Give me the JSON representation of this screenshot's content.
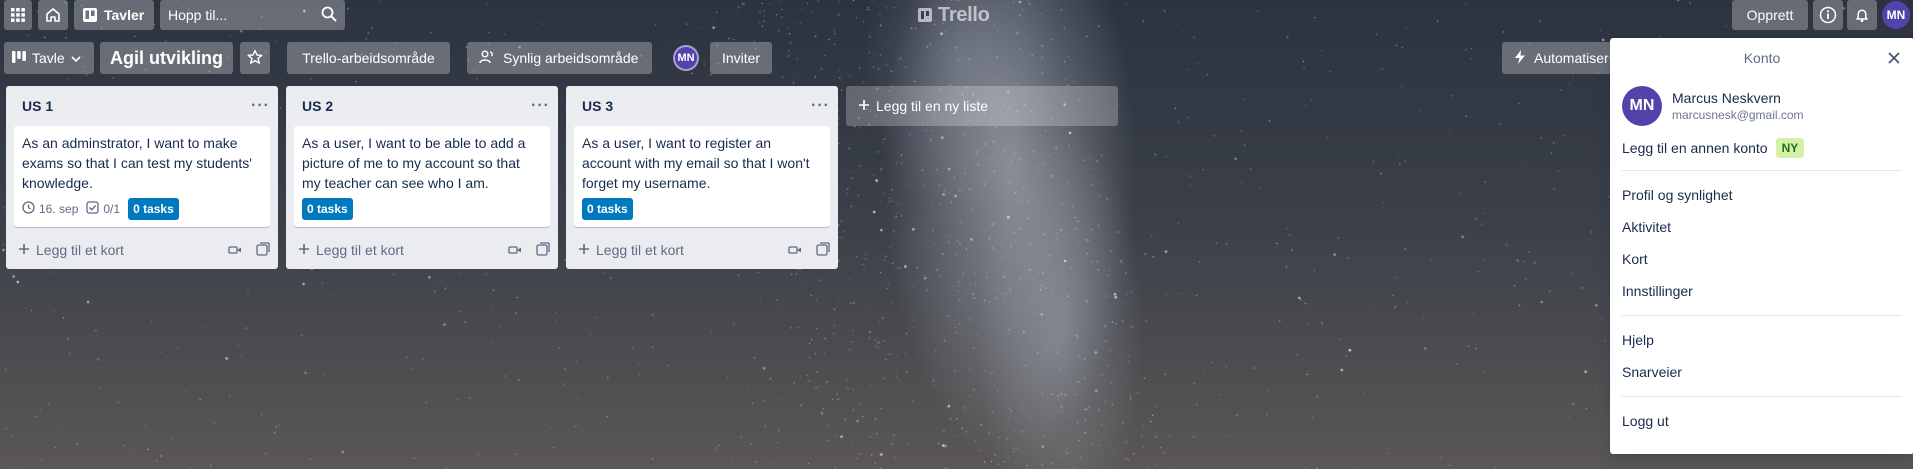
{
  "topbar": {
    "boards_label": "Tavler",
    "search_placeholder": "Hopp til...",
    "logo_text": "Trello",
    "create_label": "Opprett",
    "avatar_initials": "MN"
  },
  "board_header": {
    "view_label": "Tavle",
    "board_name": "Agil utvikling",
    "workspace_label": "Trello-arbeidsområde",
    "visibility_label": "Synlig arbeidsområde",
    "member_initials": "MN",
    "invite_label": "Inviter",
    "automation_label": "Automatiser"
  },
  "lists": [
    {
      "title": "US 1",
      "card_text": "As an adminstrator, I want to make exams so that I can test my students' knowledge.",
      "due_date": "16. sep",
      "checklist": "0/1",
      "label": "0 tasks",
      "add_card": "Legg til et kort"
    },
    {
      "title": "US 2",
      "card_text": "As a user, I want to be able to add a picture of me to my account so that my teacher can see who I am.",
      "label": "0 tasks",
      "add_card": "Legg til et kort"
    },
    {
      "title": "US 3",
      "card_text": "As a user, I want to register an account with my email so that I won't forget my username.",
      "label": "0 tasks",
      "add_card": "Legg til et kort"
    }
  ],
  "add_list_label": "Legg til en ny liste",
  "account_menu": {
    "title": "Konto",
    "avatar_initials": "MN",
    "user_name": "Marcus Neskvern",
    "user_email": "marcusnesk@gmail.com",
    "add_account": "Legg til en annen konto",
    "new_badge": "NY",
    "items_group1": [
      "Profil og synlighet",
      "Aktivitet",
      "Kort",
      "Innstillinger"
    ],
    "items_group2": [
      "Hjelp",
      "Snarveier"
    ],
    "logout": "Logg ut"
  },
  "colors": {
    "label_blue": "#0079bf",
    "avatar_purple": "#5243aa",
    "new_badge_green": "#d3f1a7"
  }
}
